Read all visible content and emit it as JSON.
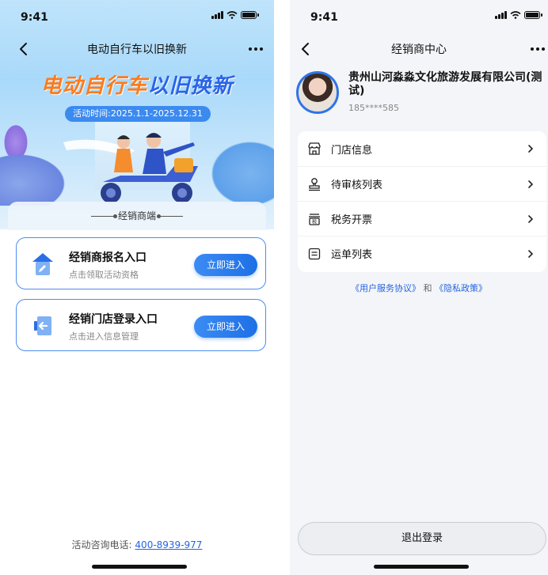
{
  "left": {
    "status": {
      "time": "9:41"
    },
    "nav": {
      "title": "电动自行车以旧换新"
    },
    "banner": {
      "headline_orange": "电动自行车",
      "headline_blue": "以旧换新",
      "dates": "活动时间:2025.1.1-2025.12.31"
    },
    "section_label": "经销商端",
    "entries": [
      {
        "title": "经销商报名入口",
        "subtitle": "点击领取活动资格",
        "button": "立即进入",
        "icon": "edit-document-icon"
      },
      {
        "title": "经销门店登录入口",
        "subtitle": "点击进入信息管理",
        "button": "立即进入",
        "icon": "login-door-icon"
      }
    ],
    "hotline": {
      "label": "活动咨询电话:",
      "number": "400-8939-977"
    }
  },
  "right": {
    "status": {
      "time": "9:41"
    },
    "nav": {
      "title": "经销商中心"
    },
    "profile": {
      "company": "贵州山河淼淼文化旅游发展有限公司(测试)",
      "phone": "185****585"
    },
    "menu": [
      {
        "label": "门店信息",
        "icon": "store-icon"
      },
      {
        "label": "待审核列表",
        "icon": "stamp-icon"
      },
      {
        "label": "税务开票",
        "icon": "tax-invoice-icon"
      },
      {
        "label": "运单列表",
        "icon": "list-icon"
      }
    ],
    "legal": {
      "user_agreement": "《用户服务协议》",
      "and": "和",
      "privacy": "《隐私政策》"
    },
    "logout": "退出登录"
  },
  "colors": {
    "accent": "#2b6fe6",
    "orange": "#ff7a1a",
    "card_border": "#4c8df0"
  }
}
